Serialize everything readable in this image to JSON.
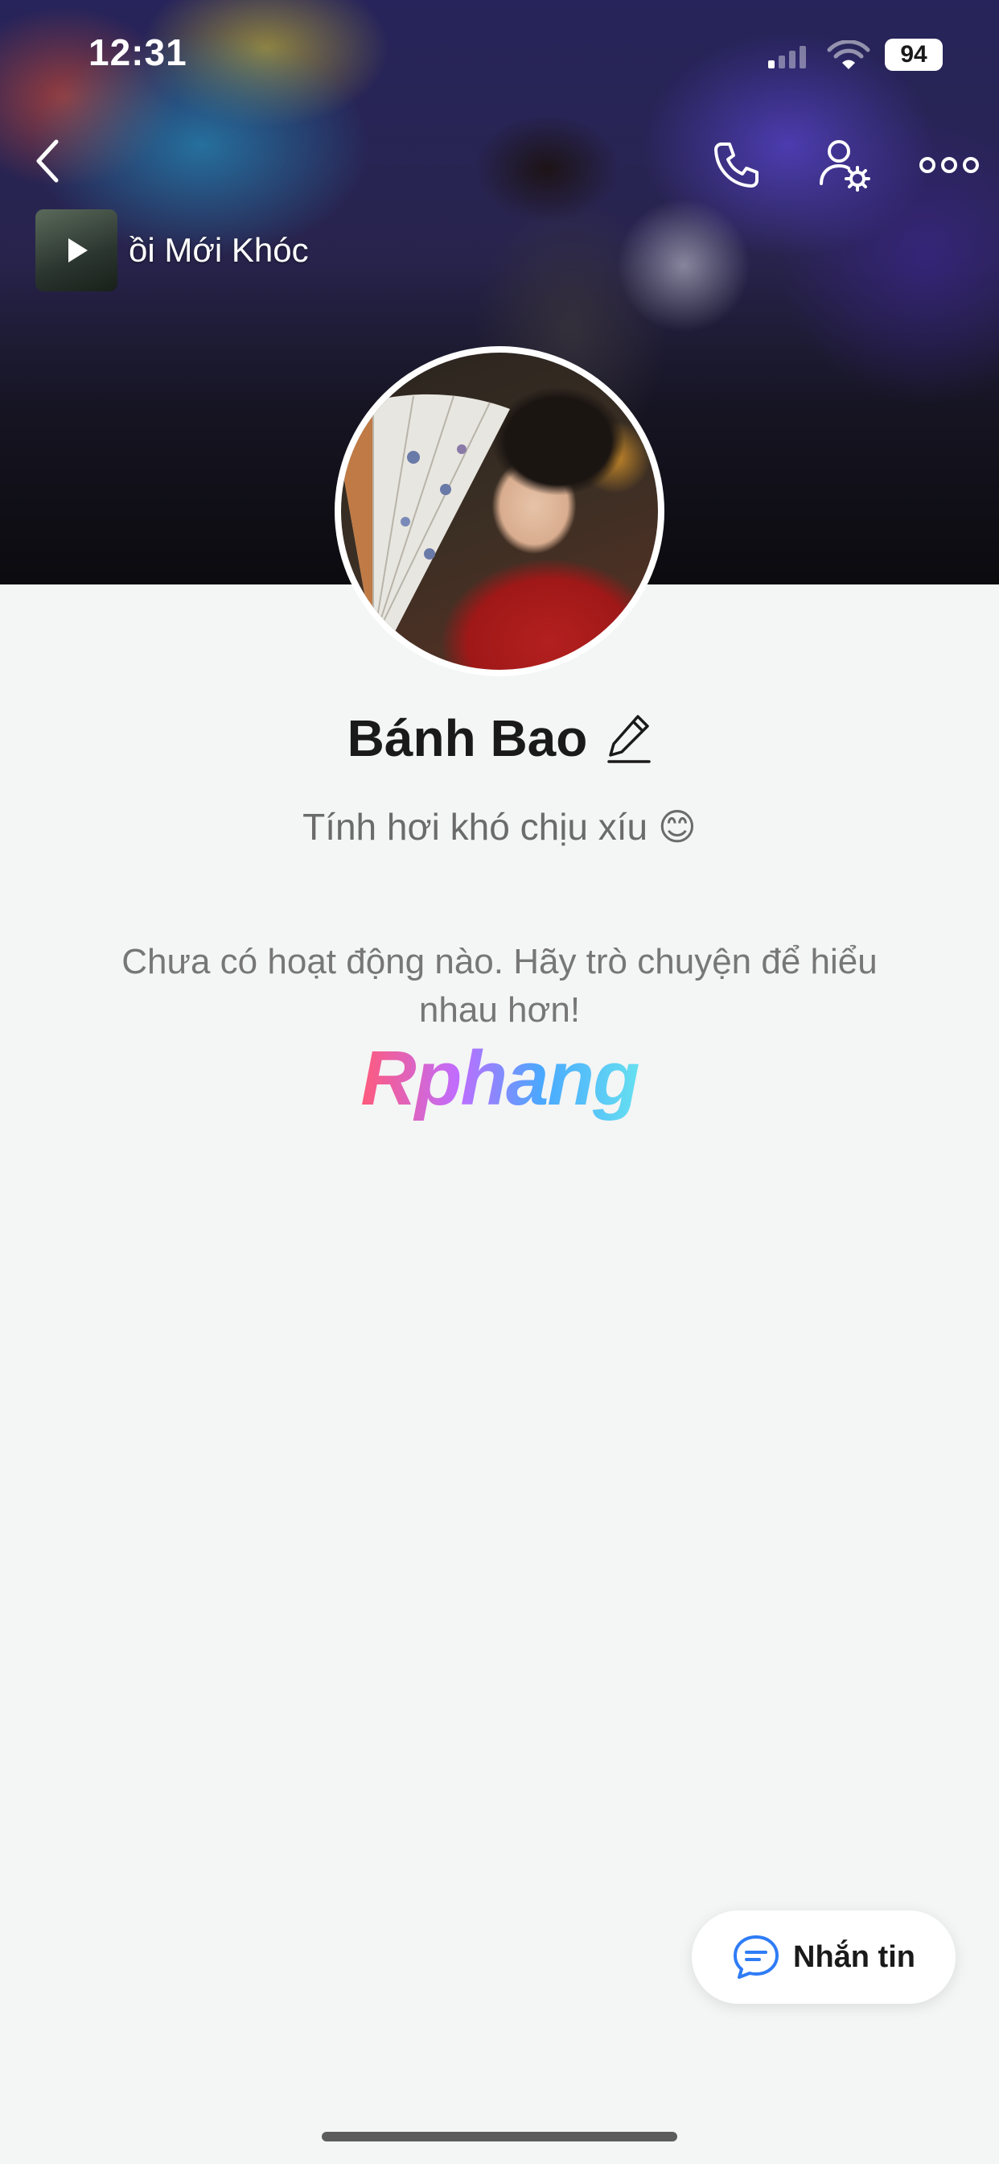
{
  "status_bar": {
    "time": "12:31",
    "battery": "94"
  },
  "header": {
    "back_icon": "chevron-left-icon",
    "call_icon": "phone-icon",
    "profile_settings_icon": "user-gear-icon",
    "more_icon": "ellipsis-icon"
  },
  "music": {
    "title": "ồi Mới Khóc",
    "play_icon": "play-icon"
  },
  "profile": {
    "name": "Bánh Bao",
    "edit_icon": "pencil-icon",
    "status": "Tính hơi khó chịu xíu 😊"
  },
  "feed": {
    "empty_message": "Chưa có hoạt động nào. Hãy trò chuyện để hiểu nhau hơn!"
  },
  "watermark": {
    "text": "Rphang"
  },
  "actions": {
    "message_label": "Nhắn tin",
    "message_icon": "chat-bubble-icon"
  },
  "colors": {
    "accent": "#2f7cf6",
    "background": "#f4f5f5",
    "text_primary": "#1a1a1a",
    "text_secondary": "#777777"
  }
}
